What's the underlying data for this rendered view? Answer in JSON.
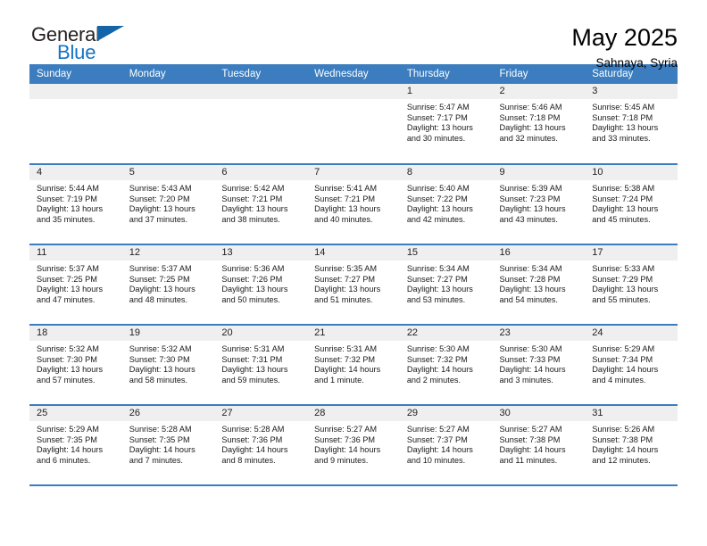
{
  "brand": {
    "name_part1": "General",
    "name_part2": "Blue",
    "accent_color": "#1474c4",
    "triangle_color": "#1464a8"
  },
  "header": {
    "title": "May 2025",
    "subtitle": "Sahnaya, Syria"
  },
  "calendar": {
    "header_bg": "#3b7dbf",
    "daynum_bg": "#efefef",
    "weekday_headers": [
      "Sunday",
      "Monday",
      "Tuesday",
      "Wednesday",
      "Thursday",
      "Friday",
      "Saturday"
    ],
    "weeks": [
      [
        {
          "day": "",
          "info": ""
        },
        {
          "day": "",
          "info": ""
        },
        {
          "day": "",
          "info": ""
        },
        {
          "day": "",
          "info": ""
        },
        {
          "day": "1",
          "info": "Sunrise: 5:47 AM\nSunset: 7:17 PM\nDaylight: 13 hours\nand 30 minutes."
        },
        {
          "day": "2",
          "info": "Sunrise: 5:46 AM\nSunset: 7:18 PM\nDaylight: 13 hours\nand 32 minutes."
        },
        {
          "day": "3",
          "info": "Sunrise: 5:45 AM\nSunset: 7:18 PM\nDaylight: 13 hours\nand 33 minutes."
        }
      ],
      [
        {
          "day": "4",
          "info": "Sunrise: 5:44 AM\nSunset: 7:19 PM\nDaylight: 13 hours\nand 35 minutes."
        },
        {
          "day": "5",
          "info": "Sunrise: 5:43 AM\nSunset: 7:20 PM\nDaylight: 13 hours\nand 37 minutes."
        },
        {
          "day": "6",
          "info": "Sunrise: 5:42 AM\nSunset: 7:21 PM\nDaylight: 13 hours\nand 38 minutes."
        },
        {
          "day": "7",
          "info": "Sunrise: 5:41 AM\nSunset: 7:21 PM\nDaylight: 13 hours\nand 40 minutes."
        },
        {
          "day": "8",
          "info": "Sunrise: 5:40 AM\nSunset: 7:22 PM\nDaylight: 13 hours\nand 42 minutes."
        },
        {
          "day": "9",
          "info": "Sunrise: 5:39 AM\nSunset: 7:23 PM\nDaylight: 13 hours\nand 43 minutes."
        },
        {
          "day": "10",
          "info": "Sunrise: 5:38 AM\nSunset: 7:24 PM\nDaylight: 13 hours\nand 45 minutes."
        }
      ],
      [
        {
          "day": "11",
          "info": "Sunrise: 5:37 AM\nSunset: 7:25 PM\nDaylight: 13 hours\nand 47 minutes."
        },
        {
          "day": "12",
          "info": "Sunrise: 5:37 AM\nSunset: 7:25 PM\nDaylight: 13 hours\nand 48 minutes."
        },
        {
          "day": "13",
          "info": "Sunrise: 5:36 AM\nSunset: 7:26 PM\nDaylight: 13 hours\nand 50 minutes."
        },
        {
          "day": "14",
          "info": "Sunrise: 5:35 AM\nSunset: 7:27 PM\nDaylight: 13 hours\nand 51 minutes."
        },
        {
          "day": "15",
          "info": "Sunrise: 5:34 AM\nSunset: 7:27 PM\nDaylight: 13 hours\nand 53 minutes."
        },
        {
          "day": "16",
          "info": "Sunrise: 5:34 AM\nSunset: 7:28 PM\nDaylight: 13 hours\nand 54 minutes."
        },
        {
          "day": "17",
          "info": "Sunrise: 5:33 AM\nSunset: 7:29 PM\nDaylight: 13 hours\nand 55 minutes."
        }
      ],
      [
        {
          "day": "18",
          "info": "Sunrise: 5:32 AM\nSunset: 7:30 PM\nDaylight: 13 hours\nand 57 minutes."
        },
        {
          "day": "19",
          "info": "Sunrise: 5:32 AM\nSunset: 7:30 PM\nDaylight: 13 hours\nand 58 minutes."
        },
        {
          "day": "20",
          "info": "Sunrise: 5:31 AM\nSunset: 7:31 PM\nDaylight: 13 hours\nand 59 minutes."
        },
        {
          "day": "21",
          "info": "Sunrise: 5:31 AM\nSunset: 7:32 PM\nDaylight: 14 hours\nand 1 minute."
        },
        {
          "day": "22",
          "info": "Sunrise: 5:30 AM\nSunset: 7:32 PM\nDaylight: 14 hours\nand 2 minutes."
        },
        {
          "day": "23",
          "info": "Sunrise: 5:30 AM\nSunset: 7:33 PM\nDaylight: 14 hours\nand 3 minutes."
        },
        {
          "day": "24",
          "info": "Sunrise: 5:29 AM\nSunset: 7:34 PM\nDaylight: 14 hours\nand 4 minutes."
        }
      ],
      [
        {
          "day": "25",
          "info": "Sunrise: 5:29 AM\nSunset: 7:35 PM\nDaylight: 14 hours\nand 6 minutes."
        },
        {
          "day": "26",
          "info": "Sunrise: 5:28 AM\nSunset: 7:35 PM\nDaylight: 14 hours\nand 7 minutes."
        },
        {
          "day": "27",
          "info": "Sunrise: 5:28 AM\nSunset: 7:36 PM\nDaylight: 14 hours\nand 8 minutes."
        },
        {
          "day": "28",
          "info": "Sunrise: 5:27 AM\nSunset: 7:36 PM\nDaylight: 14 hours\nand 9 minutes."
        },
        {
          "day": "29",
          "info": "Sunrise: 5:27 AM\nSunset: 7:37 PM\nDaylight: 14 hours\nand 10 minutes."
        },
        {
          "day": "30",
          "info": "Sunrise: 5:27 AM\nSunset: 7:38 PM\nDaylight: 14 hours\nand 11 minutes."
        },
        {
          "day": "31",
          "info": "Sunrise: 5:26 AM\nSunset: 7:38 PM\nDaylight: 14 hours\nand 12 minutes."
        }
      ]
    ]
  }
}
